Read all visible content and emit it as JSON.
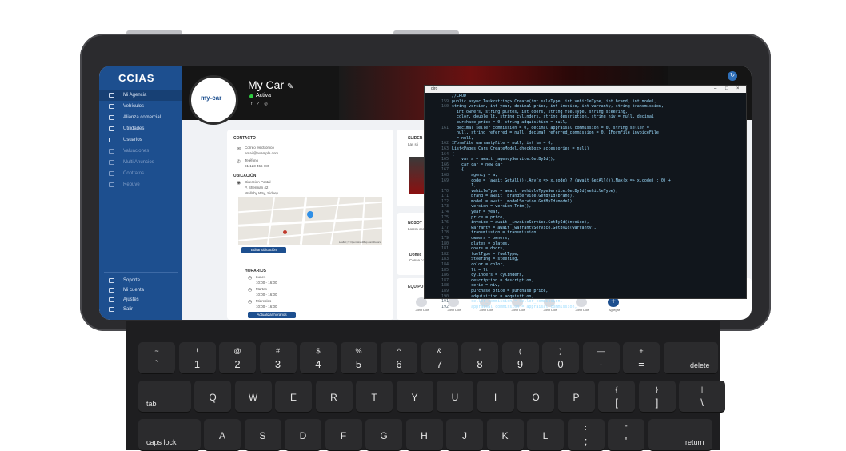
{
  "app": {
    "logo": "CCIAS"
  },
  "sidebar": {
    "items": [
      {
        "label": "Mi Agencia"
      },
      {
        "label": "Vehículos"
      },
      {
        "label": "Alianza comercial"
      },
      {
        "label": "Utilidades"
      },
      {
        "label": "Usuarios"
      },
      {
        "label": "Valuaciones"
      },
      {
        "label": "Multi Anuncios"
      },
      {
        "label": "Contratos"
      },
      {
        "label": "Repuve"
      }
    ],
    "bottom_items": [
      {
        "label": "Soporte"
      },
      {
        "label": "Mi cuenta"
      },
      {
        "label": "Ajustes"
      },
      {
        "label": "Salir"
      }
    ]
  },
  "agency": {
    "logo_text": "my-car",
    "name": "My Car",
    "status": "Activa",
    "social": "f ✓ ◎"
  },
  "contact": {
    "heading": "CONTACTO",
    "email_label": "Correo electrónico",
    "email_value": "email@example.com",
    "phone_label": "Teléfono",
    "phone_value": "81 123 456 789",
    "location_heading": "UBICACIÓN",
    "address_label": "Dirección Postal",
    "address_line1": "P. Sherman 42",
    "address_line2": "Wallaby Way, Sidney",
    "map_credit": "Leaflet | © OpenStreetMap contributors",
    "edit_location_button": "Editar ubicación"
  },
  "hours": {
    "heading": "HORARIOS",
    "rows": [
      {
        "day": "Lunes",
        "time": "10:00 - 16:00"
      },
      {
        "day": "Martes",
        "time": "10:00 - 16:00"
      },
      {
        "day": "Miércoles",
        "time": "10:00 - 16:00"
      }
    ],
    "update_button": "Actualizar horarios"
  },
  "slider": {
    "heading": "SLIDER",
    "subtitle": "Las sli"
  },
  "nosotros": {
    "heading": "NOSOT",
    "text": "Lorem consec",
    "subheading": "Domic",
    "text2": "Conse conse hendr"
  },
  "team": {
    "heading": "EQUIPO",
    "members": [
      "John Doe",
      "John Doe",
      "John Doe",
      "John Doe",
      "John Doe",
      "John Doe"
    ],
    "add_label": "Agregar"
  },
  "terminal": {
    "title": "qiro",
    "lines": [
      {
        "n": "",
        "text": "//CRUD"
      },
      {
        "n": "159",
        "text": "public async Task<string> Create(int saleType, int vehicleType, int brand, int model,"
      },
      {
        "n": "160",
        "text": "string version, int year, decimal price, int invoice, int warranty, string transmission,"
      },
      {
        "n": "",
        "text": "  int owners, string plates, int doors, string fuelType, string steering,"
      },
      {
        "n": "",
        "text": "  color, double lt, string cylinders, string description, string niv = null, decimal"
      },
      {
        "n": "",
        "text": "  purchase_price = 0, string adquisition = null,"
      },
      {
        "n": "161",
        "text": "  decimal seller_commission = 0, decimal appraisal_commission = 0, string seller ="
      },
      {
        "n": "",
        "text": "  null, string referred = null, decimal referred_commission = 0, IFormFile invoiceFile"
      },
      {
        "n": "",
        "text": "  = null,"
      },
      {
        "n": "162",
        "text": "IFormFile warrantyFile = null, int km = 0,"
      },
      {
        "n": "163",
        "text": "List<Pages.Cars.CreateModel.checkbox> accessories = null)"
      },
      {
        "n": "164",
        "text": "{"
      },
      {
        "n": "165",
        "text": "    var a = await _agencyService.GetById();"
      },
      {
        "n": "166",
        "text": "    car car = new car"
      },
      {
        "n": "167",
        "text": "    {"
      },
      {
        "n": "168",
        "text": "        agency = a,"
      },
      {
        "n": "169",
        "text": "        code = (await GetAll()).Any(x => x.code) ? (await GetAll()).Max(x => x.code) : 0) +"
      },
      {
        "n": "",
        "text": "        1,"
      },
      {
        "n": "170",
        "text": "        vehicleType = await _vehicleTypeService.GetById(vehicleType),"
      },
      {
        "n": "171",
        "text": "        brand = await _brandService.GetById(brand),"
      },
      {
        "n": "172",
        "text": "        model = await _modelService.GetById(model),"
      },
      {
        "n": "173",
        "text": "        version = version.Trim(),"
      },
      {
        "n": "174",
        "text": "        year = year,"
      },
      {
        "n": "175",
        "text": "        price = price,"
      },
      {
        "n": "176",
        "text": "        invoice = await _invoiceService.GetById(invoice),"
      },
      {
        "n": "177",
        "text": "        warranty = await _warrantyService.GetById(warranty),"
      },
      {
        "n": "178",
        "text": "        transmission = transmission,"
      },
      {
        "n": "179",
        "text": "        owners = owners,"
      },
      {
        "n": "180",
        "text": "        plates = plates,"
      },
      {
        "n": "181",
        "text": "        doors = doors,"
      },
      {
        "n": "182",
        "text": "        fuelType = fuelType,"
      },
      {
        "n": "183",
        "text": "        Steering = steering,"
      },
      {
        "n": "184",
        "text": "        color = color,"
      },
      {
        "n": "185",
        "text": "        lt = lt,"
      },
      {
        "n": "186",
        "text": "        cylinders = cylinders,"
      },
      {
        "n": "187",
        "text": "        description = description,"
      },
      {
        "n": "188",
        "text": "        serie = niv,"
      },
      {
        "n": "189",
        "text": "        purchase_price = purchase_price,"
      },
      {
        "n": "190",
        "text": "        adquisition = adquisition,"
      },
      {
        "n": "191",
        "text": "        seller_commission = seller_commission,"
      },
      {
        "n": "192",
        "text": "        appraisal_commission = appraisal_commission,"
      }
    ]
  },
  "keyboard": {
    "row1": [
      {
        "top": "~",
        "bottom": "`"
      },
      {
        "top": "!",
        "bottom": "1"
      },
      {
        "top": "@",
        "bottom": "2"
      },
      {
        "top": "#",
        "bottom": "3"
      },
      {
        "top": "$",
        "bottom": "4"
      },
      {
        "top": "%",
        "bottom": "5"
      },
      {
        "top": "^",
        "bottom": "6"
      },
      {
        "top": "&",
        "bottom": "7"
      },
      {
        "top": "*",
        "bottom": "8"
      },
      {
        "top": "(",
        "bottom": "9"
      },
      {
        "top": ")",
        "bottom": "0"
      },
      {
        "top": "—",
        "bottom": "-"
      },
      {
        "top": "+",
        "bottom": "="
      }
    ],
    "delete_label": "delete",
    "tab_label": "tab",
    "row2": [
      "Q",
      "W",
      "E",
      "R",
      "T",
      "Y",
      "U",
      "I",
      "O",
      "P"
    ],
    "row2_brackets": [
      {
        "top": "{",
        "bottom": "["
      },
      {
        "top": "}",
        "bottom": "]"
      },
      {
        "top": "|",
        "bottom": "\\"
      }
    ],
    "caps_label": "caps lock",
    "row3": [
      "A",
      "S",
      "D",
      "F",
      "G",
      "H",
      "J",
      "K",
      "L"
    ],
    "row3_punct": [
      {
        "top": ":",
        "bottom": ";"
      },
      {
        "top": "\"",
        "bottom": "'"
      }
    ],
    "return_label": "return"
  },
  "colors": {
    "sidebar": "#1d4f8f",
    "accent": "#1d4f8f",
    "status": "#2ecc40"
  }
}
